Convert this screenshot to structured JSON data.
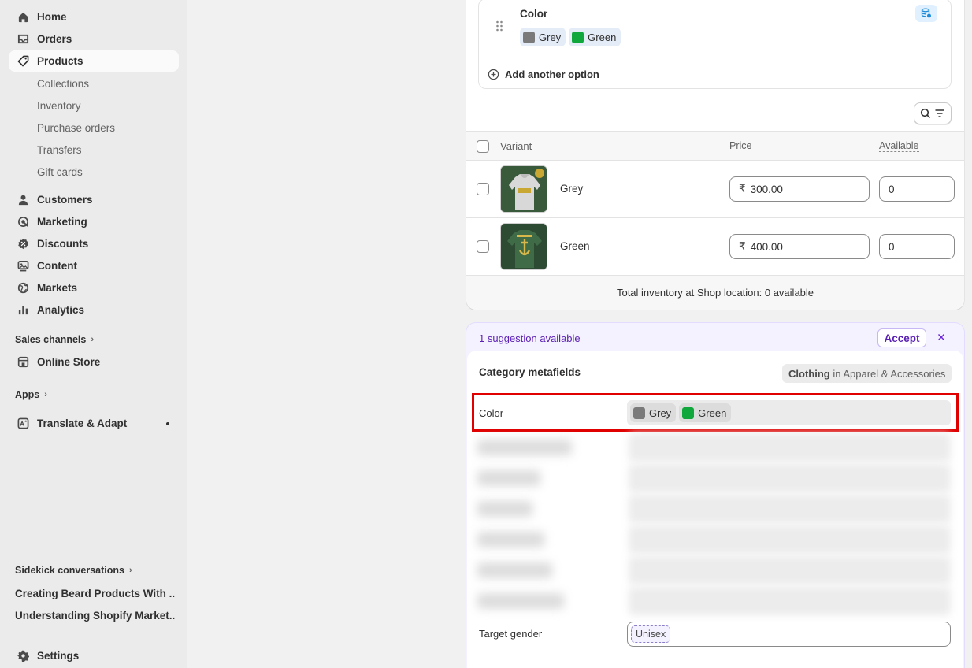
{
  "sidebar": {
    "primary": [
      {
        "label": "Home",
        "icon": "home-icon"
      },
      {
        "label": "Orders",
        "icon": "inbox-icon"
      },
      {
        "label": "Products",
        "icon": "tag-icon"
      }
    ],
    "product_sub": [
      "Collections",
      "Inventory",
      "Purchase orders",
      "Transfers",
      "Gift cards"
    ],
    "secondary": [
      {
        "label": "Customers",
        "icon": "person-icon"
      },
      {
        "label": "Marketing",
        "icon": "target-icon"
      },
      {
        "label": "Discounts",
        "icon": "discount-icon"
      },
      {
        "label": "Content",
        "icon": "image-icon"
      },
      {
        "label": "Markets",
        "icon": "globe-icon"
      },
      {
        "label": "Analytics",
        "icon": "bar-chart-icon"
      }
    ],
    "sales_channels_label": "Sales channels",
    "online_store_label": "Online Store",
    "apps_label": "Apps",
    "translate_label": "Translate & Adapt",
    "sidekick_label": "Sidekick conversations",
    "sidekick_items": [
      "Creating Beard Products With ...",
      "Understanding Shopify Market..."
    ],
    "settings_label": "Settings"
  },
  "options": {
    "option_name": "Color",
    "values": [
      {
        "label": "Grey",
        "color": "#7a7a7a"
      },
      {
        "label": "Green",
        "color": "#10a83c"
      }
    ],
    "add_option_label": "Add another option"
  },
  "variants": {
    "headers": {
      "variant": "Variant",
      "price": "Price",
      "available": "Available"
    },
    "rows": [
      {
        "name": "Grey",
        "price": "300.00",
        "available": "0"
      },
      {
        "name": "Green",
        "price": "400.00",
        "available": "0"
      }
    ],
    "currency_symbol": "₹",
    "total_inventory": "Total inventory at Shop location: 0 available"
  },
  "metafields": {
    "suggestion_text": "1 suggestion available",
    "accept_label": "Accept",
    "title": "Category metafields",
    "category_strong": "Clothing",
    "category_rest": " in Apparel & Accessories",
    "color_label": "Color",
    "color_values": [
      {
        "label": "Grey",
        "color": "#7a7a7a"
      },
      {
        "label": "Green",
        "color": "#10a83c"
      }
    ],
    "target_gender_label": "Target gender",
    "target_gender_value": "Unisex"
  },
  "colors": {
    "highlight_border": "#e00000",
    "suggestion_purple": "#5b21b6",
    "accent_blue": "#1f8ad8"
  }
}
